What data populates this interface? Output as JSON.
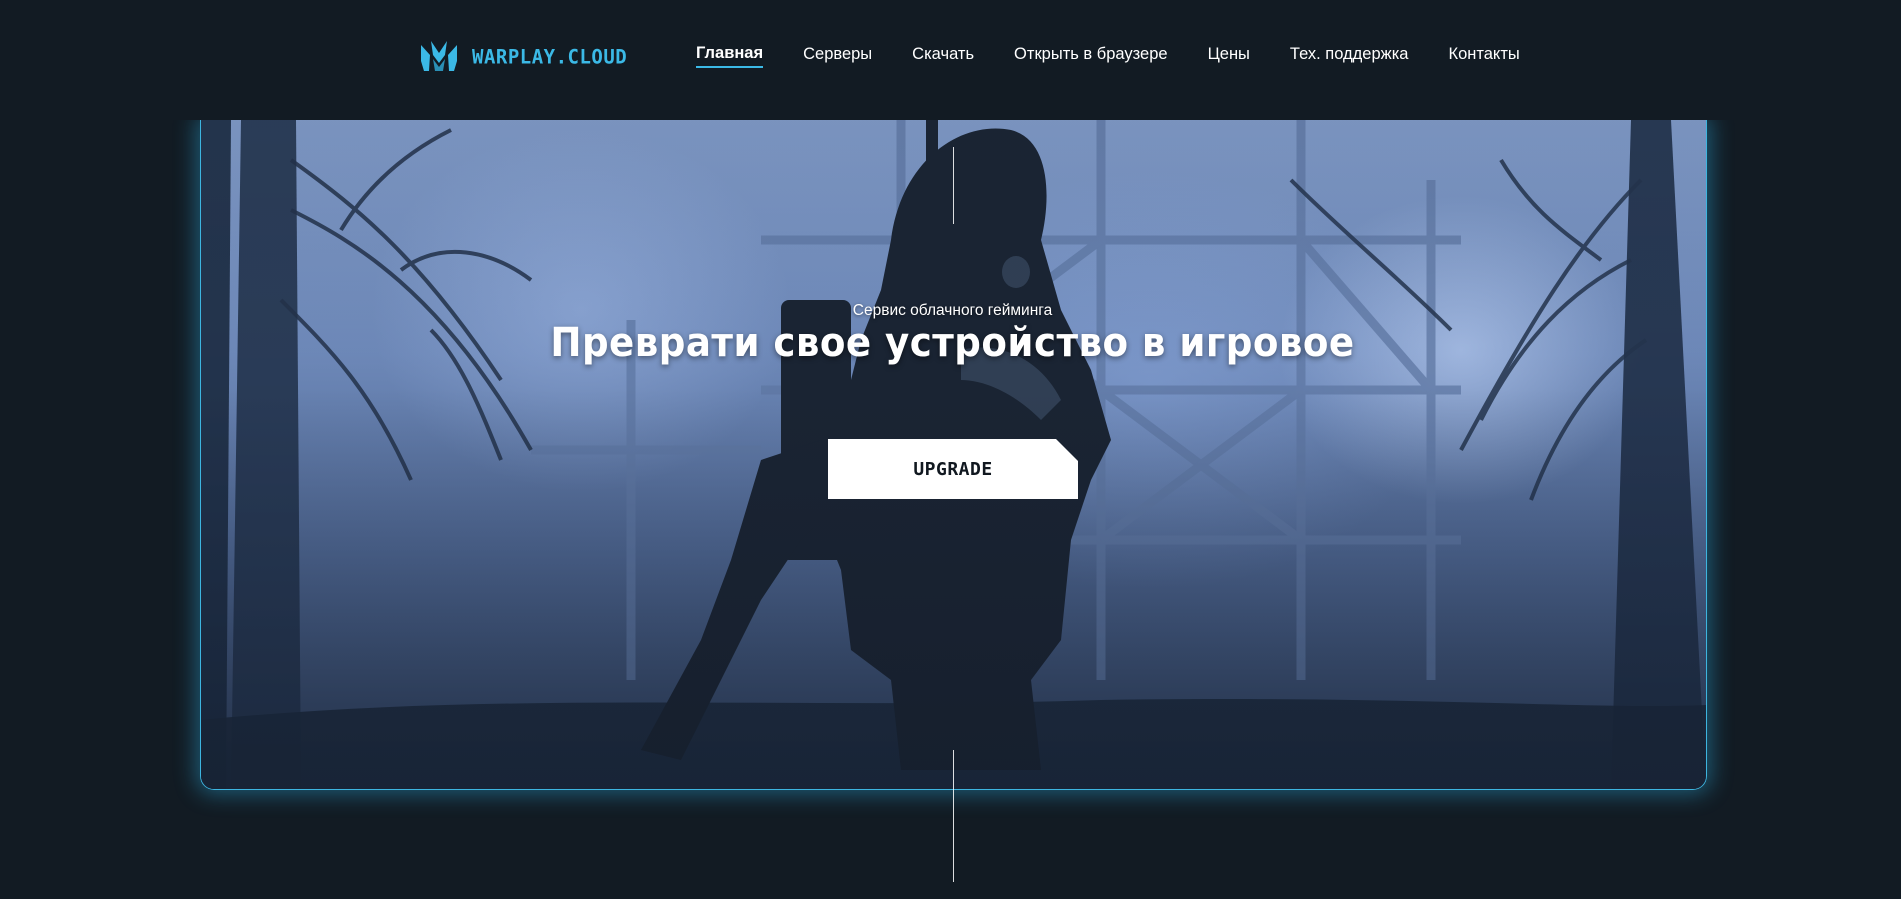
{
  "header": {
    "logo_text": "WARPLAY.CLOUD",
    "logo_icon": "warplay-logo-icon",
    "accent_color": "#3bb9e6",
    "nav": [
      {
        "label": "Главная",
        "active": true
      },
      {
        "label": "Серверы",
        "active": false
      },
      {
        "label": "Скачать",
        "active": false
      },
      {
        "label": "Открыть в браузере",
        "active": false
      },
      {
        "label": "Цены",
        "active": false
      },
      {
        "label": "Тех. поддержка",
        "active": false
      },
      {
        "label": "Контакты",
        "active": false
      }
    ]
  },
  "hero": {
    "subtitle": "Сервис облачного гейминга",
    "title": "Преврати свое устройство в игровое",
    "button_label": "UPGRADE",
    "border_color": "#3db5e0"
  },
  "colors": {
    "background": "#121b23",
    "button_bg": "#ffffff",
    "button_text": "#111820"
  }
}
